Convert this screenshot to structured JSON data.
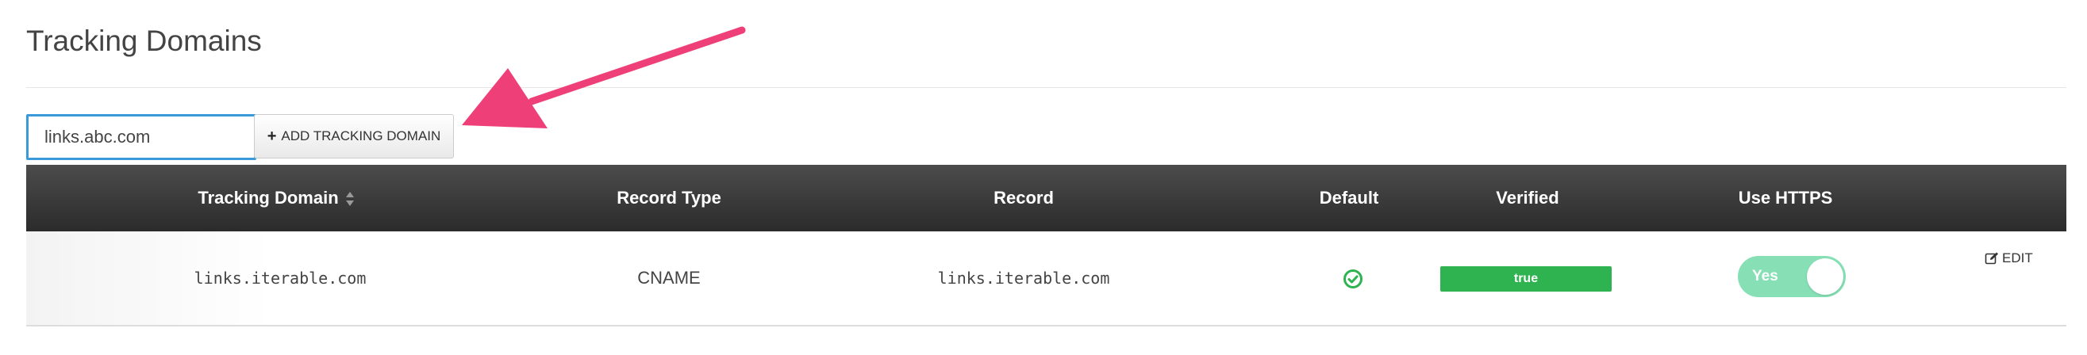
{
  "page": {
    "title": "Tracking Domains"
  },
  "add_form": {
    "input_value": "links.abc.com",
    "button_label": "ADD TRACKING DOMAIN",
    "button_icon": "plus-icon"
  },
  "table": {
    "columns": [
      {
        "label": "Tracking Domain",
        "sortable": true
      },
      {
        "label": "Record Type"
      },
      {
        "label": "Record"
      },
      {
        "label": "Default"
      },
      {
        "label": "Verified"
      },
      {
        "label": "Use HTTPS"
      }
    ],
    "rows": [
      {
        "tracking_domain": "links.iterable.com",
        "record_type": "CNAME",
        "record": "links.iterable.com",
        "default_icon": "check-circle-icon",
        "verified": "true",
        "use_https_label": "Yes",
        "use_https_on": true,
        "edit_label": "EDIT",
        "edit_icon": "edit-icon"
      }
    ]
  },
  "colors": {
    "header_bg": "#3a3a3a",
    "verified_green": "#2fb350",
    "toggle_on": "#86dfb5",
    "input_focus_border": "#3a9ad9",
    "annotation_arrow": "#ef3f78",
    "check_green": "#2fb350"
  }
}
